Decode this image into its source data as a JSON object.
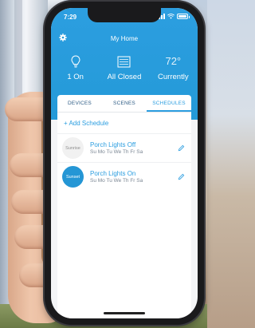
{
  "status_bar": {
    "time": "7:29"
  },
  "header": {
    "title": "My Home",
    "stats": [
      {
        "icon": "lightbulb-icon",
        "label": "1 On"
      },
      {
        "icon": "garage-door-icon",
        "label": "All Closed"
      },
      {
        "icon": "temperature",
        "value": "72°",
        "label": "Currently"
      }
    ]
  },
  "tabs": [
    {
      "label": "DEVICES",
      "active": false
    },
    {
      "label": "SCENES",
      "active": false
    },
    {
      "label": "SCHEDULES",
      "active": true
    }
  ],
  "add_schedule_label": "+ Add Schedule",
  "schedules": [
    {
      "badge": "Sunrise",
      "title": "Porch Lights Off",
      "days": "Su Mo Tu We Th Fr Sa"
    },
    {
      "badge": "Sunset",
      "title": "Porch Lights On",
      "days": "Su Mo Tu We Th Fr Sa"
    }
  ],
  "colors": {
    "accent": "#2c9ee0",
    "header_bg": "#249ad8",
    "sunset_badge": "#2496d5"
  }
}
